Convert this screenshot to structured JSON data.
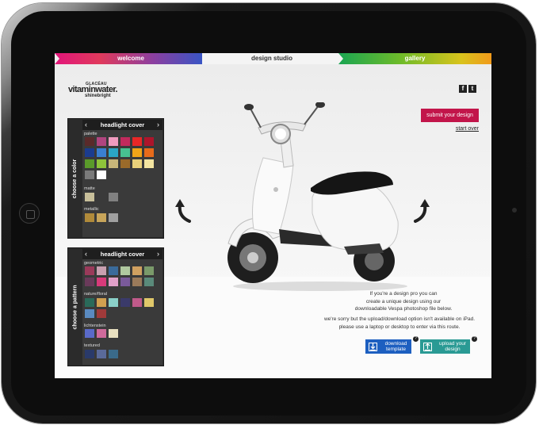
{
  "nav": {
    "welcome": "welcome",
    "design_studio": "design studio",
    "gallery": "gallery"
  },
  "brand": {
    "line1": "GLACÉAU",
    "line2": "vitaminwater.",
    "line3": "shinebright"
  },
  "social": {
    "facebook": "f",
    "twitter": "t"
  },
  "actions": {
    "submit": "submit your design",
    "start_over": "start over"
  },
  "color_panel": {
    "side_label": "choose a color",
    "header": "headlight cover",
    "groups": [
      "palette",
      "matte",
      "metallic"
    ],
    "palette": [
      "#5a2a2a",
      "#b0457f",
      "#ef9bbf",
      "#c12a5d",
      "#e82727",
      "#ad152b",
      "#1b3c8f",
      "#3a7fd0",
      "#2aa6c6",
      "#47c191",
      "#f0a418",
      "#e86b1a",
      "#5a9a2a",
      "#8fc43a",
      "#c7b67a",
      "#9a6a2a",
      "#e8d07a",
      "#f3e4a0",
      "#7a7a7a",
      "#ffffff"
    ],
    "matte": [
      "#c8bf9a",
      "#3a3a3a",
      "#808080"
    ],
    "metallic": [
      "#b08a3a",
      "#c8a55a",
      "#a0a0a0"
    ]
  },
  "pattern_panel": {
    "side_label": "choose a pattern",
    "header": "headlight cover",
    "groups": [
      "geometric",
      "nature/floral",
      "lichtenstein",
      "textured"
    ],
    "geometric": [
      "#9a3a5a",
      "#c8a0b0",
      "#3a6a9a",
      "#b0c8a0",
      "#d0a060",
      "#7a9a6a",
      "#6a3a5a",
      "#d83a7a",
      "#e0a0c8",
      "#7a5a9a",
      "#9a7a5a",
      "#5a8a7a"
    ],
    "floral": [
      "#2a6a5a",
      "#d0a050",
      "#8ad0c8",
      "#3a3a6a",
      "#c05a8a",
      "#e0c86a",
      "#5a8ac0",
      "#a03a3a"
    ],
    "lichtenstein": [
      "#5a6ac8",
      "#d06a9a",
      "#e8e0c0"
    ],
    "textured": [
      "#2a3a6a",
      "#5a6a9a",
      "#3a6a8a"
    ]
  },
  "info": {
    "p1_l1": "If you're a design pro you can",
    "p1_l2": "create a unique design using our",
    "p1_l3": "downloadable Vespa photoshop file below.",
    "p2_l1": "we're sorry but the upload/download option isn't available on iPad.",
    "p2_l2": "please use a laptop or desktop to enter via this route.",
    "download_l1": "download",
    "download_l2": "template",
    "upload_l1": "upload your",
    "upload_l2": "design",
    "help": "?"
  },
  "icons": [
    "rotate-left-arrow-icon",
    "rotate-right-arrow-icon",
    "download-icon",
    "upload-icon",
    "chevron-left-icon",
    "chevron-right-icon",
    "home-button-icon"
  ]
}
